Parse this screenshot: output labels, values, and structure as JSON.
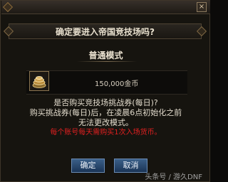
{
  "dialog": {
    "question": "确定要进入帝国竞技场吗?",
    "close_symbol": "×"
  },
  "mode": {
    "title": "普通模式"
  },
  "reward": {
    "icon": "gold-coins-icon",
    "amount": "150,000金币"
  },
  "info": {
    "line1": "是否购买竞技场挑战券(每日)?",
    "line2": "购买挑战券(每日)后，在凌晨6点初始化之前",
    "line3": "无法更改模式。",
    "warning": "每个账号每天需购买1次入场货币。"
  },
  "buttons": {
    "confirm": "确定",
    "cancel": "取消"
  },
  "watermark": "头条号 / 游久DNF",
  "colors": {
    "warning": "#e02020",
    "button": "#2b4a70"
  }
}
